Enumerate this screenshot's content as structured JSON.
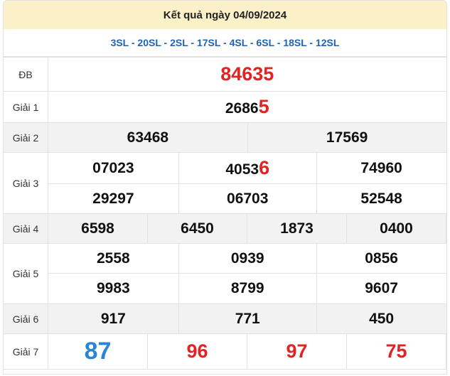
{
  "header": {
    "title": "Kết quả ngày 04/09/2024"
  },
  "sl_line": "3SL - 20SL - 2SL - 17SL - 4SL - 6SL - 18SL - 12SL",
  "labels": {
    "db": "ĐB",
    "g1": "Giải 1",
    "g2": "Giải 2",
    "g3": "Giải 3",
    "g4": "Giải 4",
    "g5": "Giải 5",
    "g6": "Giải 6",
    "g7": "Giải 7"
  },
  "results": {
    "db": "84635",
    "g1_prefix": "2686",
    "g1_last": "5",
    "g2": [
      "63468",
      "17569"
    ],
    "g3_row1_a": "07023",
    "g3_row1_b_prefix": "4053",
    "g3_row1_b_last": "6",
    "g3_row1_c": "74960",
    "g3_row2": [
      "29297",
      "06703",
      "52548"
    ],
    "g4": [
      "6598",
      "6450",
      "1873",
      "0400"
    ],
    "g5_row1": [
      "2558",
      "0939",
      "0856"
    ],
    "g5_row2": [
      "9983",
      "8799",
      "9607"
    ],
    "g6": [
      "917",
      "771",
      "450"
    ],
    "g7": [
      "87",
      "96",
      "97",
      "75"
    ]
  },
  "colors": {
    "header_bg": "#fbf0c8",
    "sl_text": "#1f63b5",
    "highlight_red": "#e02424",
    "highlight_blue": "#2a84d8"
  }
}
